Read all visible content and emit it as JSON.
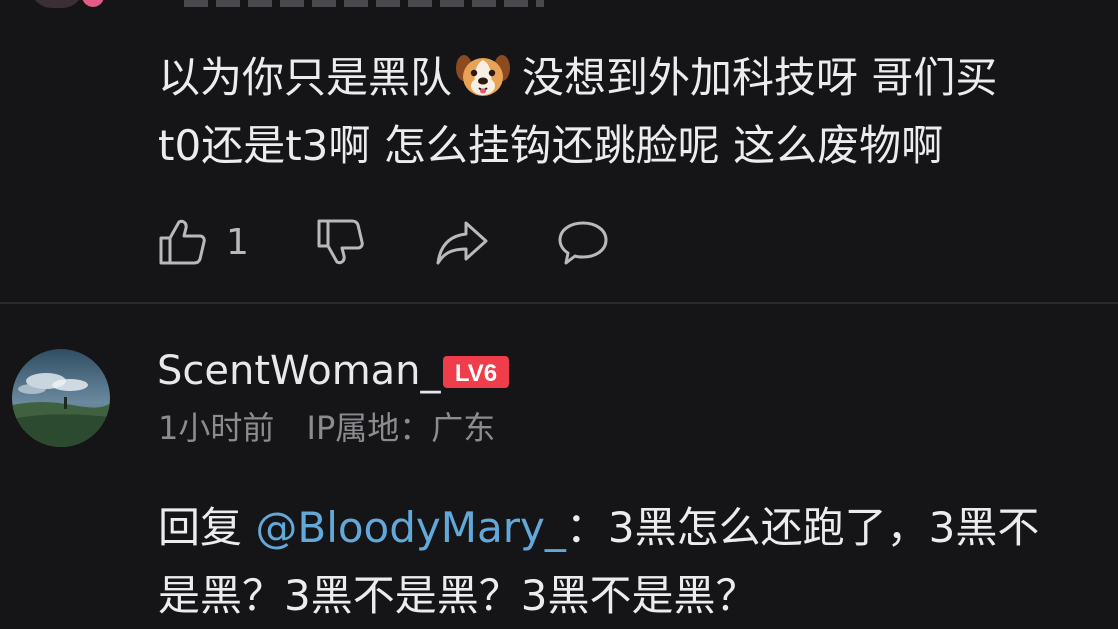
{
  "comment_top": {
    "line1_part1": "以为你只是黑队",
    "emoji": "dog-face-emoji",
    "line1_part2": "没想到外加科技呀 哥们买",
    "line2": "t0还是t3啊 怎么挂钩还跳脸呢 这么废物啊",
    "actions": {
      "like_count": "1",
      "like_icon": "thumbs-up-icon",
      "dislike_icon": "thumbs-down-icon",
      "share_icon": "share-arrow-icon",
      "reply_icon": "comment-bubble-icon"
    }
  },
  "reply_comment": {
    "username": "ScentWoman_",
    "level_badge": "LV6",
    "time": "1小时前",
    "ip_location": "IP属地：广东",
    "reply_prefix": "回复",
    "mention": "@BloodyMary_",
    "line1_rest": "：3黑怎么还跑了，3黑不",
    "line2": "是黑？3黑不是黑？3黑不是黑？"
  },
  "colors": {
    "background": "#151517",
    "text": "#ececee",
    "muted": "#8b8b90",
    "mention": "#62a8d9",
    "badge_red": "#ef3d4b"
  }
}
